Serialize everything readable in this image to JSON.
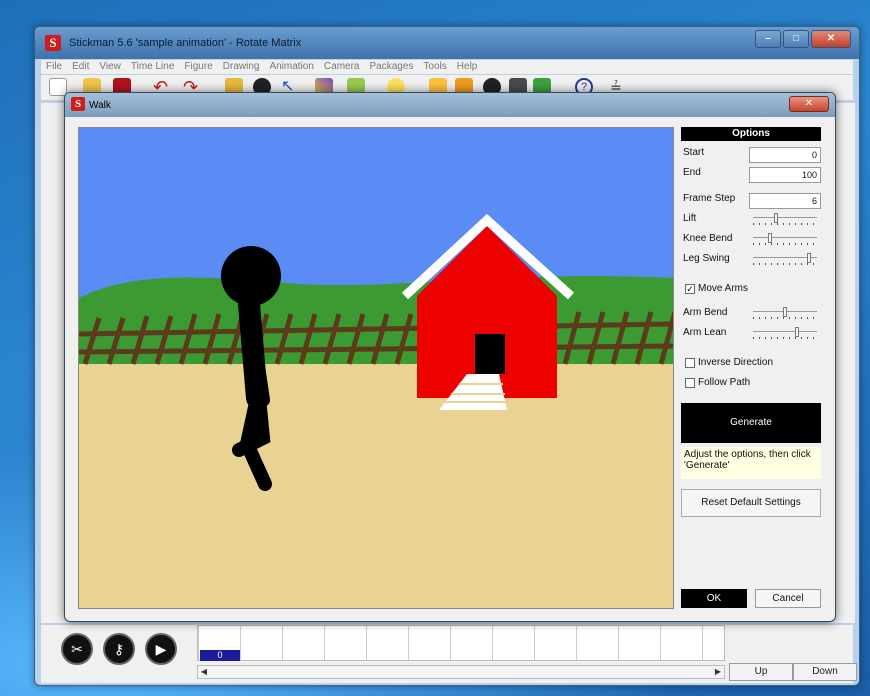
{
  "main_window": {
    "title": "Stickman 5.6  'sample animation' - Rotate Matrix",
    "menu": [
      "File",
      "Edit",
      "View",
      "Time Line",
      "Figure",
      "Drawing",
      "Animation",
      "Camera",
      "Packages",
      "Tools",
      "Help"
    ],
    "frame_number": "0",
    "up_label": "Up",
    "down_label": "Down",
    "window_buttons": {
      "minimize": "–",
      "maximize": "□",
      "close": "✕"
    }
  },
  "dialog": {
    "title": "Walk",
    "close_glyph": "✕",
    "options_header": "Options",
    "start_label": "Start",
    "start_value": "0",
    "end_label": "End",
    "end_value": "100",
    "frame_step_label": "Frame Step",
    "frame_step_value": "6",
    "sliders": [
      {
        "label": "Lift",
        "level": 0.35
      },
      {
        "label": "Knee Bend",
        "level": 0.25
      },
      {
        "label": "Leg Swing",
        "level": 0.9
      }
    ],
    "move_arms_label": "Move Arms",
    "move_arms_checked": true,
    "arm_sliders": [
      {
        "label": "Arm Bend",
        "level": 0.5
      },
      {
        "label": "Arm Lean",
        "level": 0.7
      }
    ],
    "inverse_direction_label": "Inverse Direction",
    "follow_path_label": "Follow Path",
    "generate_label": "Generate",
    "hint_text": "Adjust the options, then click 'Generate'",
    "reset_label": "Reset Default Settings",
    "ok_label": "OK",
    "cancel_label": "Cancel"
  },
  "colors": {
    "sky": "#5b8bf5",
    "grass": "#3b9b32",
    "ground": "#e8d393",
    "fence": "#5c3a1c",
    "house": "#ee0000",
    "roof": "#ffffff"
  }
}
